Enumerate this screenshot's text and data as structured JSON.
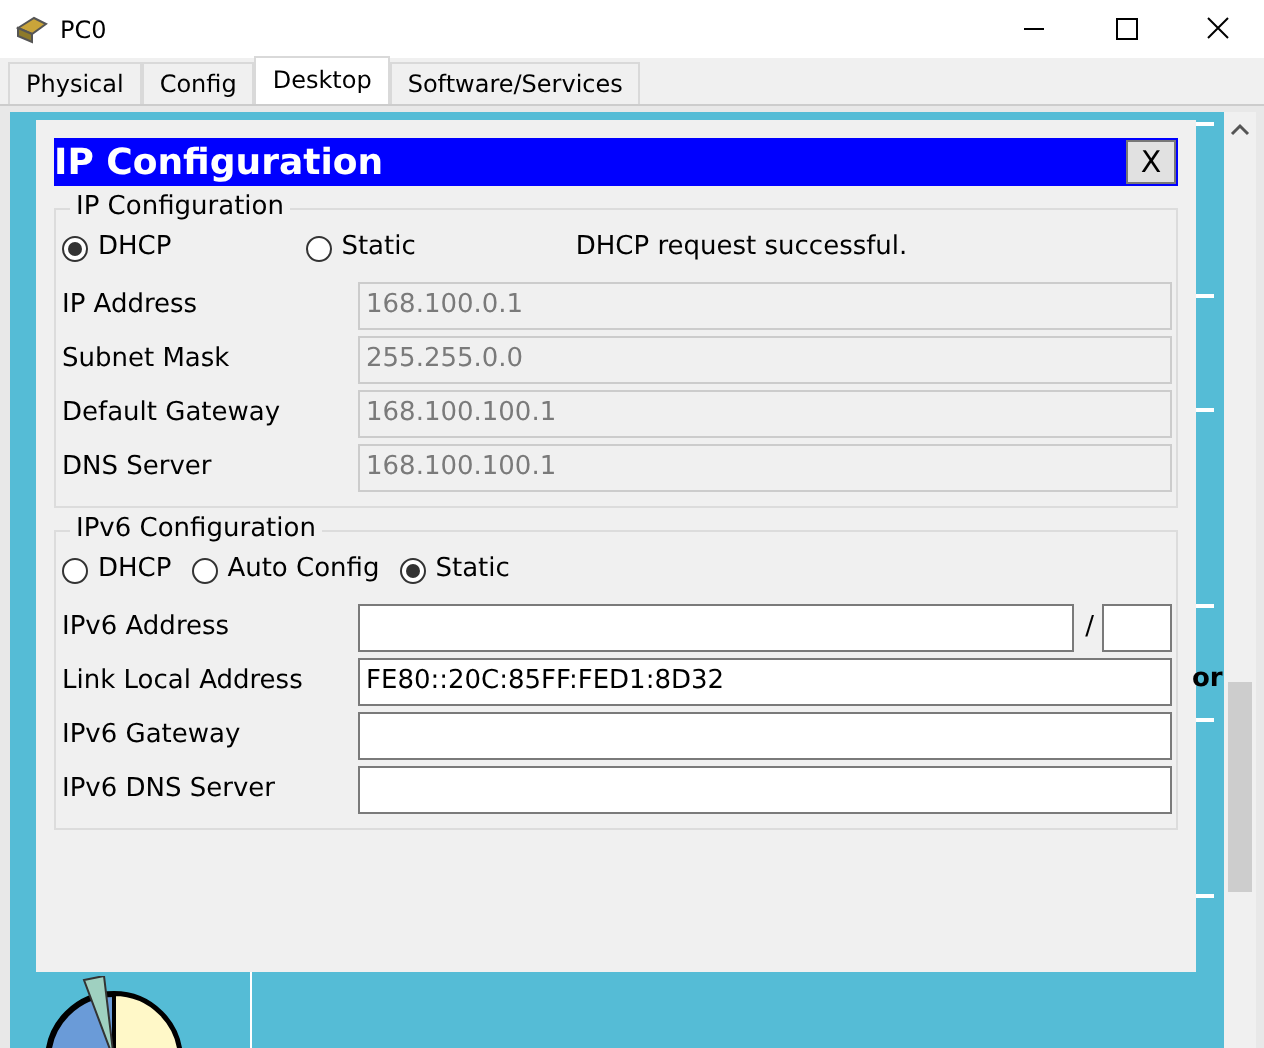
{
  "window": {
    "title": "PC0"
  },
  "tabs": [
    {
      "label": "Physical",
      "selected": false
    },
    {
      "label": "Config",
      "selected": false
    },
    {
      "label": "Desktop",
      "selected": true
    },
    {
      "label": "Software/Services",
      "selected": false
    }
  ],
  "desktop": {
    "background_labels": [
      "or"
    ]
  },
  "dialog": {
    "title": "IP Configuration",
    "close": "X",
    "ipv4": {
      "legend": "IP Configuration",
      "modes": [
        {
          "label": "DHCP",
          "selected": true
        },
        {
          "label": "Static",
          "selected": false
        }
      ],
      "status": "DHCP request successful.",
      "fields": [
        {
          "label": "IP Address",
          "value": "168.100.0.1",
          "disabled": true
        },
        {
          "label": "Subnet Mask",
          "value": "255.255.0.0",
          "disabled": true
        },
        {
          "label": "Default Gateway",
          "value": "168.100.100.1",
          "disabled": true
        },
        {
          "label": "DNS Server",
          "value": "168.100.100.1",
          "disabled": true
        }
      ]
    },
    "ipv6": {
      "legend": "IPv6 Configuration",
      "modes": [
        {
          "label": "DHCP",
          "selected": false
        },
        {
          "label": "Auto Config",
          "selected": false
        },
        {
          "label": "Static",
          "selected": true
        }
      ],
      "fields": [
        {
          "label": "IPv6 Address",
          "kind": "prefixed",
          "separator": "/",
          "disabled": false
        },
        {
          "label": "Link Local Address",
          "value": "FE80::20C:85FF:FED1:8D32",
          "disabled": false
        },
        {
          "label": "IPv6 Gateway",
          "disabled": false
        },
        {
          "label": "IPv6 DNS Server",
          "disabled": false
        }
      ]
    }
  }
}
